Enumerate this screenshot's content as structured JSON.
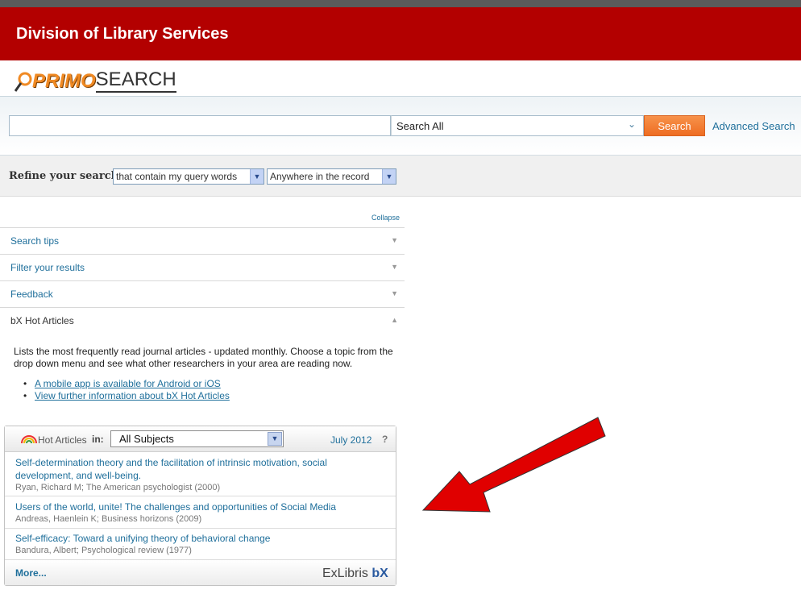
{
  "header": {
    "title": "Division of Library Services"
  },
  "logo": {
    "part1": "PRIMO",
    "part2": "SEARCH"
  },
  "search": {
    "input_value": "",
    "scope": "Search All",
    "button": "Search",
    "advanced": "Advanced Search"
  },
  "refine": {
    "label": "Refine your search:",
    "option1": "that contain my query words",
    "option2": "Anywhere in the record"
  },
  "sidebar": {
    "collapse": "Collapse",
    "items": [
      {
        "label": "Search tips"
      },
      {
        "label": "Filter your results"
      },
      {
        "label": "Feedback"
      },
      {
        "label": "bX Hot Articles"
      }
    ]
  },
  "bx": {
    "description": "Lists the most frequently read journal articles - updated monthly. Choose a topic from the drop down menu and see what other researchers in your area are reading now.",
    "links": [
      "A mobile app is available for Android or iOS",
      "View further information about bX Hot Articles"
    ]
  },
  "widget": {
    "title": "Hot Articles",
    "in_label": "in:",
    "subject": "All Subjects",
    "date": "July 2012",
    "help": "?",
    "articles": [
      {
        "title": "Self-determination theory and the facilitation of intrinsic motivation, social development, and well-being.",
        "meta": "Ryan, Richard M; The American psychologist (2000)"
      },
      {
        "title": "Users of the world, unite! The challenges and opportunities of Social Media",
        "meta": "Andreas, Haenlein K; Business horizons (2009)"
      },
      {
        "title": "Self-efficacy: Toward a unifying theory of behavioral change",
        "meta": "Bandura, Albert; Psychological review (1977)"
      }
    ],
    "more": "More...",
    "brand1": "ExLibris",
    "brand2": "bX"
  },
  "colors": {
    "banner": "#b30000",
    "link": "#1f6f9b",
    "search_button": "#ee6d22",
    "arrow": "#e00000"
  }
}
